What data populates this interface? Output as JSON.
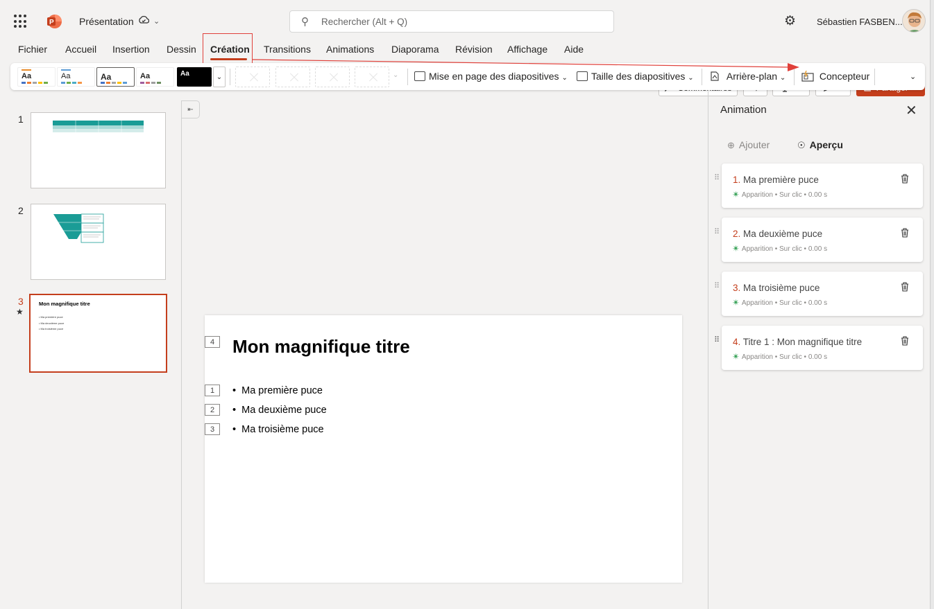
{
  "app": {
    "doc_title": "Présentation",
    "search_placeholder": "Rechercher (Alt + Q)",
    "user_name": "Sébastien FASBEN..."
  },
  "menu": {
    "tabs": [
      {
        "label": "Fichier"
      },
      {
        "label": "Accueil"
      },
      {
        "label": "Insertion"
      },
      {
        "label": "Dessin"
      },
      {
        "label": "Création"
      },
      {
        "label": "Transitions"
      },
      {
        "label": "Animations"
      },
      {
        "label": "Diaporama"
      },
      {
        "label": "Révision"
      },
      {
        "label": "Affichage"
      },
      {
        "label": "Aide"
      }
    ],
    "active_tab": "Création"
  },
  "actions": {
    "comments_label": "Commentaires",
    "share_label": "Partager"
  },
  "ribbon": {
    "theme_aa": "Aa",
    "layout_label": "Mise en page des diapositives",
    "size_label": "Taille des diapositives",
    "background_label": "Arrière-plan",
    "designer_label": "Concepteur"
  },
  "thumbnails": [
    {
      "number": "1"
    },
    {
      "number": "2"
    },
    {
      "number": "3",
      "title": "Mon magnifique titre",
      "bullets": [
        "Ma première puce",
        "Ma deuxième puce",
        "Ma troisième puce"
      ]
    }
  ],
  "slide": {
    "title": "Mon magnifique titre",
    "title_tag": "4",
    "bullets": [
      {
        "tag": "1",
        "text": "Ma première puce"
      },
      {
        "tag": "2",
        "text": "Ma deuxième puce"
      },
      {
        "tag": "3",
        "text": "Ma troisième puce"
      }
    ]
  },
  "animation_panel": {
    "title": "Animation",
    "add_label": "Ajouter",
    "preview_label": "Aperçu",
    "items": [
      {
        "num": "1.",
        "label": "Ma première puce",
        "meta": "Apparition • Sur clic • 0.00 s"
      },
      {
        "num": "2.",
        "label": "Ma deuxième puce",
        "meta": "Apparition • Sur clic • 0.00 s"
      },
      {
        "num": "3.",
        "label": "Ma troisième puce",
        "meta": "Apparition • Sur clic • 0.00 s"
      },
      {
        "num": "4.",
        "label": "Titre 1 : Mon magnifique titre",
        "meta": "Apparition • Sur clic • 0.00 s"
      }
    ]
  },
  "colors": {
    "accent": "#c43e1c",
    "highlight": "#e0403a",
    "teal": "#1a9c96"
  }
}
